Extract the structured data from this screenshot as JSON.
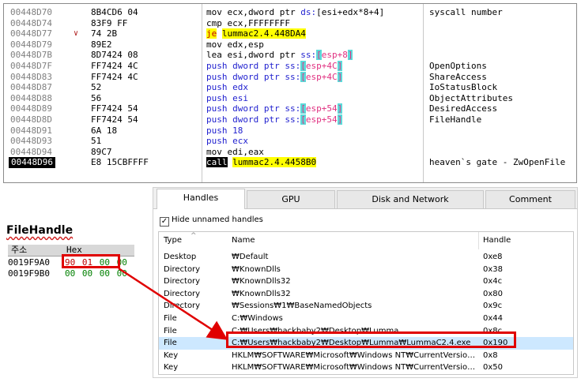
{
  "disasm": {
    "rows": [
      {
        "addr": "00448D70",
        "bytes": "8B4CD6 04",
        "mnem": "mov",
        "ops": "ecx,dword ptr ds:[esi+edx*8+4]",
        "comment": "syscall number"
      },
      {
        "addr": "00448D74",
        "bytes": "83F9 FF",
        "mnem": "cmp",
        "ops": "ecx,FFFFFFFF",
        "comment": ""
      },
      {
        "addr": "00448D77",
        "bytes": "74 2B",
        "mnem": "je",
        "ops": "lummac2.4.448DA4",
        "comment": "",
        "arrow": "∨"
      },
      {
        "addr": "00448D79",
        "bytes": "89E2",
        "mnem": "mov",
        "ops": "edx,esp",
        "comment": ""
      },
      {
        "addr": "00448D7B",
        "bytes": "8D7424 08",
        "mnem": "lea",
        "ops": "esi,dword ptr ss:[esp+8]",
        "comment": ""
      },
      {
        "addr": "00448D7F",
        "bytes": "FF7424 4C",
        "mnem": "push",
        "ops": "dword ptr ss:[esp+4C]",
        "comment": "OpenOptions"
      },
      {
        "addr": "00448D83",
        "bytes": "FF7424 4C",
        "mnem": "push",
        "ops": "dword ptr ss:[esp+4C]",
        "comment": "ShareAccess"
      },
      {
        "addr": "00448D87",
        "bytes": "52",
        "mnem": "push",
        "ops": "edx",
        "comment": "IoStatusBlock"
      },
      {
        "addr": "00448D88",
        "bytes": "56",
        "mnem": "push",
        "ops": "esi",
        "comment": "ObjectAttributes"
      },
      {
        "addr": "00448D89",
        "bytes": "FF7424 54",
        "mnem": "push",
        "ops": "dword ptr ss:[esp+54]",
        "comment": "DesiredAccess"
      },
      {
        "addr": "00448D8D",
        "bytes": "FF7424 54",
        "mnem": "push",
        "ops": "dword ptr ss:[esp+54]",
        "comment": "FileHandle"
      },
      {
        "addr": "00448D91",
        "bytes": "6A 18",
        "mnem": "push",
        "ops": "18",
        "comment": ""
      },
      {
        "addr": "00448D93",
        "bytes": "51",
        "mnem": "push",
        "ops": "ecx",
        "comment": ""
      },
      {
        "addr": "00448D94",
        "bytes": "89C7",
        "mnem": "mov",
        "ops": "edi,eax",
        "comment": ""
      },
      {
        "addr": "00448D96",
        "bytes": "E8 15CBFFFF",
        "mnem": "call",
        "ops": "lummac2.4.4458B0",
        "comment": "heaven`s gate - ZwOpenFile"
      }
    ]
  },
  "dump": {
    "title": "FileHandle",
    "col_addr": "주소",
    "col_hex": "Hex",
    "rows": [
      {
        "addr": "0019F9A0",
        "b0": "90",
        "b1": "01",
        "b2": "00",
        "b3": "00"
      },
      {
        "addr": "0019F9B0",
        "b0": "00",
        "b1": "00",
        "b2": "00",
        "b3": "00"
      }
    ]
  },
  "handles": {
    "tabs": [
      "Handles",
      "GPU",
      "Disk and Network",
      "Comment"
    ],
    "hide_unnamed_label": "Hide unnamed handles",
    "columns": {
      "type": "Type",
      "name": "Name",
      "handle": "Handle"
    },
    "rows": [
      {
        "type": "Desktop",
        "name": "₩Default",
        "handle": "0xe8"
      },
      {
        "type": "Directory",
        "name": "₩KnownDlls",
        "handle": "0x38"
      },
      {
        "type": "Directory",
        "name": "₩KnownDlls32",
        "handle": "0x4c"
      },
      {
        "type": "Directory",
        "name": "₩KnownDlls32",
        "handle": "0x80"
      },
      {
        "type": "Directory",
        "name": "₩Sessions₩1₩BaseNamedObjects",
        "handle": "0x9c"
      },
      {
        "type": "File",
        "name": "C:₩Windows",
        "handle": "0x44"
      },
      {
        "type": "File",
        "name": "C:₩Users₩hackbaby2₩Desktop₩Lumma",
        "handle": "0x8c"
      },
      {
        "type": "File",
        "name": "C:₩Users₩hackbaby2₩Desktop₩Lumma₩LummaC2.4.exe",
        "handle": "0x190"
      },
      {
        "type": "Key",
        "name": "HKLM₩SOFTWARE₩Microsoft₩Windows NT₩CurrentVersion₩Image ...",
        "handle": "0x8"
      },
      {
        "type": "Key",
        "name": "HKLM₩SOFTWARE₩Microsoft₩Windows NT₩CurrentVersion₩Image ...",
        "handle": "0x50"
      }
    ]
  },
  "colors": {
    "highlight": "#e00000",
    "selected_row": "#cde8ff",
    "jump_bg": "#ffff00"
  }
}
